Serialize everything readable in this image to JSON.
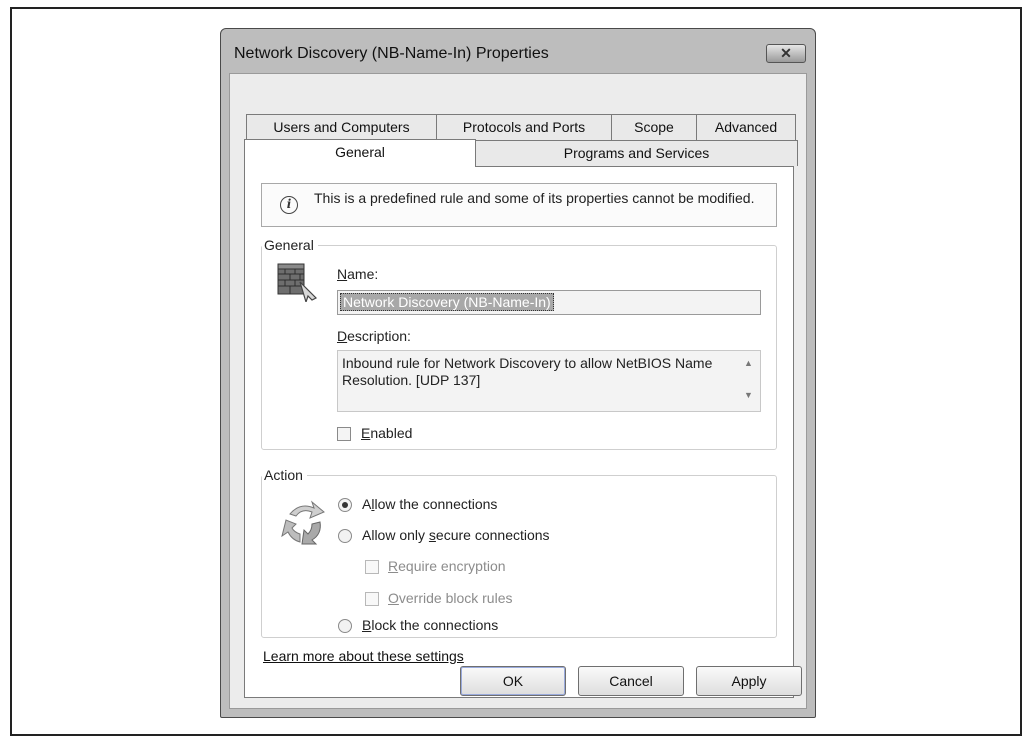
{
  "window": {
    "title": "Network Discovery (NB-Name-In) Properties",
    "close_glyph": "✕"
  },
  "tabs": {
    "row1": [
      "Users and Computers",
      "Protocols and Ports",
      "Scope",
      "Advanced"
    ],
    "row2": [
      "General",
      "Programs and Services"
    ],
    "active": "General"
  },
  "info": {
    "icon": "info-icon",
    "icon_glyph": "i",
    "text": "This is a predefined rule and some of its properties cannot be modified."
  },
  "general_group": {
    "legend": "General",
    "name_label_key": "N",
    "name_label_rest": "ame:",
    "name_value": "Network Discovery (NB-Name-In)",
    "description_label_key": "D",
    "description_label_rest": "escription:",
    "description_value": "Inbound rule for Network Discovery to allow NetBIOS Name Resolution. [UDP 137]",
    "enabled_label_key": "E",
    "enabled_label_rest": "nabled",
    "enabled_checked": false,
    "scroll_up": "▲",
    "scroll_down": "▼"
  },
  "action_group": {
    "legend": "Action",
    "allow_label_pre": "A",
    "allow_label_key": "l",
    "allow_label_rest": "low the connections",
    "secure_label_pre": "Allow only ",
    "secure_label_key": "s",
    "secure_label_rest": "ecure connections",
    "require_enc_key": "R",
    "require_enc_rest": "equire encryption",
    "override_key": "O",
    "override_rest": "verride block rules",
    "block_key": "B",
    "block_rest": "lock the connections",
    "selected": "allow"
  },
  "learn_more": "Learn more about these settings",
  "buttons": {
    "ok": "OK",
    "cancel": "Cancel",
    "apply": "Apply"
  }
}
